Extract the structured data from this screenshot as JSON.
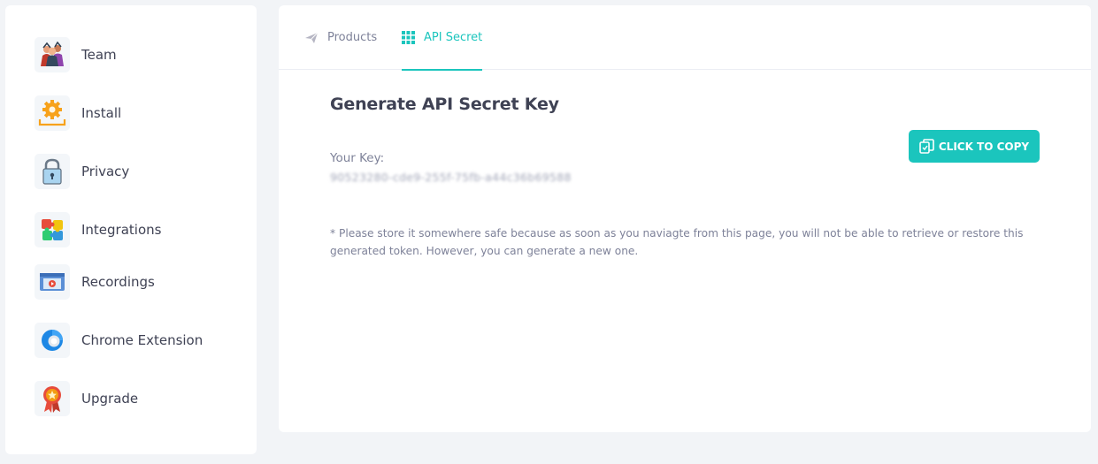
{
  "sidebar": {
    "items": [
      {
        "label": "Team",
        "icon": "team-icon"
      },
      {
        "label": "Install",
        "icon": "install-gear-icon"
      },
      {
        "label": "Privacy",
        "icon": "padlock-icon"
      },
      {
        "label": "Integrations",
        "icon": "puzzle-icon"
      },
      {
        "label": "Recordings",
        "icon": "video-player-icon"
      },
      {
        "label": "Chrome Extension",
        "icon": "chrome-extension-icon"
      },
      {
        "label": "Upgrade",
        "icon": "award-badge-icon"
      }
    ]
  },
  "tabs": [
    {
      "label": "Products",
      "icon": "paper-plane-icon",
      "active": false
    },
    {
      "label": "API Secret",
      "icon": "grid-icon",
      "active": true
    }
  ],
  "content": {
    "title": "Generate API Secret Key",
    "key_label": "Your Key:",
    "key_value": "90523280-cde9-255f-75fb-a44c36b69588",
    "copy_button": "CLICK TO COPY",
    "note": "* Please store it somewhere safe because as soon as you naviagte from this page, you will not be able to retrieve or restore this generated token. However, you can generate a new one."
  },
  "colors": {
    "accent": "#1bc5bd",
    "page_bg": "#f2f4f7",
    "text_dark": "#3f4254",
    "text_muted": "#7e8299"
  }
}
